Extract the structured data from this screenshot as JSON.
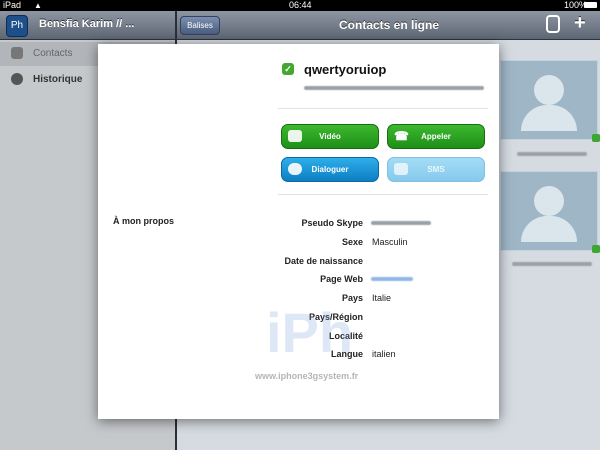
{
  "statusbar": {
    "carrier": "iPad",
    "time": "06:44",
    "battery": "100%"
  },
  "left_nav": {
    "app_icon_text": "Ph",
    "title": "Bensfia Karim // ..."
  },
  "right_nav": {
    "back_label": "Balises",
    "title": "Contacts en ligne",
    "phone_icon": "phone-icon",
    "add_label": "+"
  },
  "sidebar": {
    "items": [
      {
        "label": "Contacts",
        "icon": "contacts-icon"
      },
      {
        "label": "Historique",
        "icon": "clock-icon"
      }
    ]
  },
  "profile": {
    "username": "qwertyoruiop",
    "status_icon": "online-check-icon",
    "buttons": {
      "video": "Vidéo",
      "call": "Appeler",
      "chat": "Dialoguer",
      "sms": "SMS"
    },
    "section_title": "À mon propos",
    "fields": [
      {
        "label": "Pseudo Skype",
        "value": ""
      },
      {
        "label": "Sexe",
        "value": "Masculin"
      },
      {
        "label": "Date de naissance",
        "value": ""
      },
      {
        "label": "Page Web",
        "value": ""
      },
      {
        "label": "Pays",
        "value": "Italie"
      },
      {
        "label": "Pays/Région",
        "value": ""
      },
      {
        "label": "Localité",
        "value": ""
      },
      {
        "label": "Langue",
        "value": "italien"
      }
    ]
  },
  "watermark": {
    "logo": "iPh",
    "url": "www.iphone3gsystem.fr"
  },
  "colors": {
    "green_button": "#2aa322",
    "blue_button": "#1b95d6",
    "online": "#44a72f"
  }
}
